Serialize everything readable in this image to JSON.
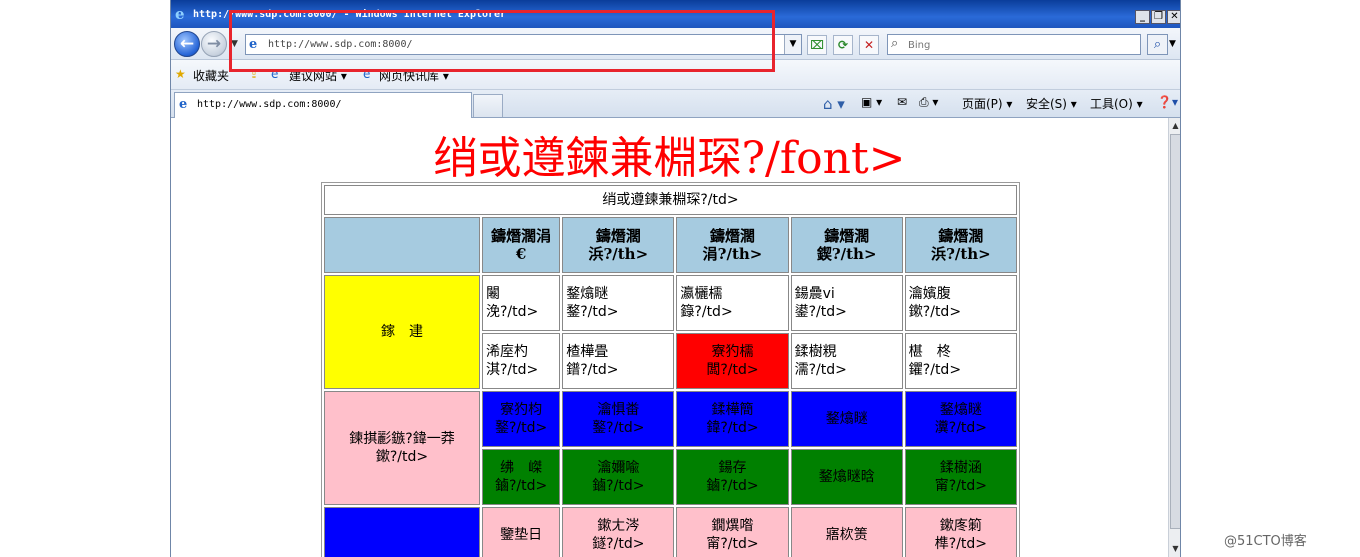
{
  "window": {
    "title": "http://www.sdp.com:8000/ - Windows Internet Explorer",
    "min_label": "_",
    "restore_label": "❐",
    "close_label": "✕"
  },
  "nav": {
    "address": "http://www.sdp.com:8000/",
    "search_placeholder": "Bing"
  },
  "favorites": {
    "label": "收藏夹",
    "items": [
      "建议网站 ▾",
      "网页快讯库 ▾"
    ]
  },
  "tab": {
    "title": "http://www.sdp.com:8000/"
  },
  "commands": {
    "page": "页面(P) ▾",
    "safety": "安全(S) ▾",
    "tools": "工具(O) ▾"
  },
  "page": {
    "heading": "绡或遵鍊兼棩琛?/font>",
    "caption": "绡或遵鍊兼棩琛?/td>",
    "headers": [
      "鑄熸濶涓€",
      "鑄熸濶浜?/th>",
      "鑄熸濶涓?/th>",
      "鑄熸濶鍥?/th>",
      "鑄熸濶浜?/th>"
    ],
    "group1": "鎵　䢖",
    "row1": [
      "闂\n浼?/td>",
      "鍪熻瞇\n鍪?/td>",
      "瀛欐檽\n籙?/td>",
      "鍚曟vi\n鍙?/td>",
      "瀹嬪腹\n鏉?/td>"
    ],
    "row2": [
      "浠庢杓\n淇?/td>",
      "楂樺畳\n鐠?/td>",
      "寮犳檽\n闆?/td>",
      "鍒樹粯\n濡?/td>",
      "椹　柊\n鑺?/td>"
    ],
    "group2": "鍊掑彲鏃?鍏一莽\n鏉?/td>",
    "row3": [
      "寮犳枃\n鐜?/td>",
      "瀹惧畨\n鐜?/td>",
      "鍒樺簡\n鍏?/td>",
      "鍪熻瞇",
      "鍪熻瞇\n瀵?/td>"
    ],
    "row4": [
      "绋　嵥\n鏀?/td>",
      "瀹嬭喩\n鏀?/td>",
      "鍚存\n鏀?/td>",
      "鍪熻瞇晗",
      "鍒樹涵\n甯?/td>"
    ],
    "row5": [
      "鑒垫日",
      "鏉ㄤ涔\n鐩?/td>",
      "鐗熼喒\n甯?/td>",
      "寤栨箦",
      "鏉庝箣\n榫?/td>"
    ]
  },
  "watermark": "@51CTO博客"
}
